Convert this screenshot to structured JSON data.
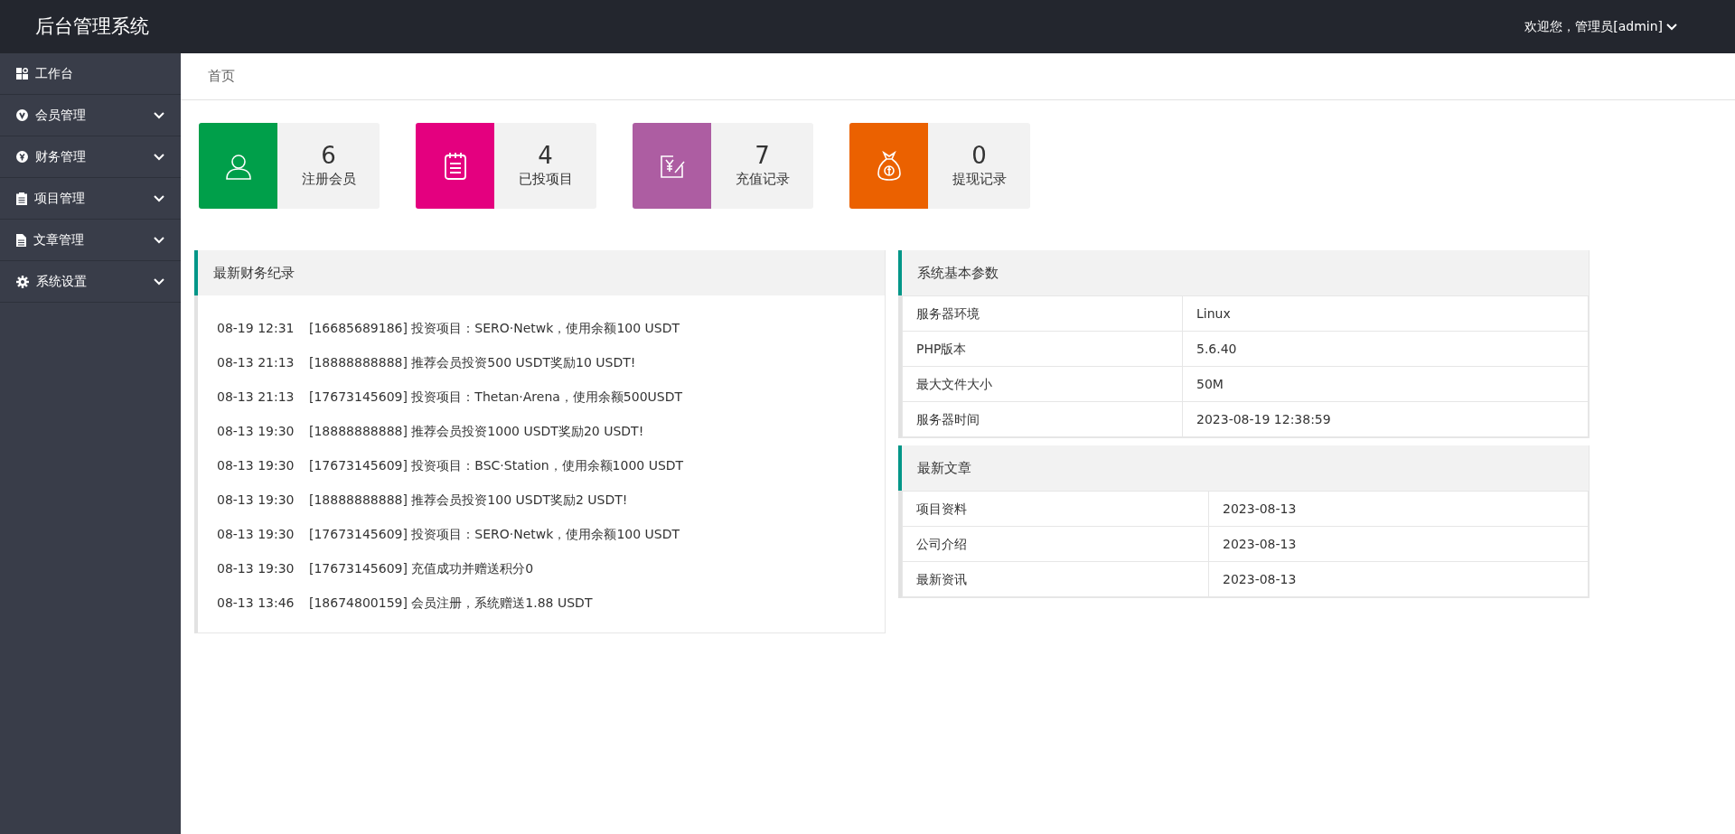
{
  "header": {
    "title": "后台管理系统",
    "user_menu": "欢迎您，管理员[admin]"
  },
  "sidebar": {
    "items": [
      {
        "label": "工作台",
        "kind": "link"
      },
      {
        "label": "会员管理",
        "kind": "menu",
        "expanded": false
      },
      {
        "label": "财务管理",
        "kind": "menu",
        "expanded": false
      },
      {
        "label": "项目管理",
        "kind": "menu",
        "expanded": false
      },
      {
        "label": "文章管理",
        "kind": "menu",
        "expanded": false
      },
      {
        "label": "系统设置",
        "kind": "menu",
        "expanded": false
      }
    ]
  },
  "breadcrumb": "首页",
  "stats": [
    {
      "value": "6",
      "label": "注册会员",
      "color": "#009f4a"
    },
    {
      "value": "4",
      "label": "已投项目",
      "color": "#e4007f"
    },
    {
      "value": "7",
      "label": "充值记录",
      "color": "#ad5da2"
    },
    {
      "value": "0",
      "label": "提现记录",
      "color": "#eb6100"
    }
  ],
  "finance_log": {
    "title": "最新财务纪录",
    "entries": [
      {
        "time": "08-19 12:31",
        "text": "[16685689186] 投资项目：SERO·Netwk，使用余额100 USDT"
      },
      {
        "time": "08-13 21:13",
        "text": "[18888888888] 推荐会员投资500 USDT奖励10 USDT!"
      },
      {
        "time": "08-13 21:13",
        "text": "[17673145609] 投资项目：Thetan·Arena，使用余额500USDT"
      },
      {
        "time": "08-13 19:30",
        "text": "[18888888888] 推荐会员投资1000 USDT奖励20 USDT!"
      },
      {
        "time": "08-13 19:30",
        "text": "[17673145609] 投资项目：BSC·Station，使用余额1000 USDT"
      },
      {
        "time": "08-13 19:30",
        "text": "[18888888888] 推荐会员投资100 USDT奖励2 USDT!"
      },
      {
        "time": "08-13 19:30",
        "text": "[17673145609] 投资项目：SERO·Netwk，使用余额100 USDT"
      },
      {
        "time": "08-13 19:30",
        "text": "[17673145609] 充值成功并赠送积分0"
      },
      {
        "time": "08-13 13:46",
        "text": "[18674800159] 会员注册，系统赠送1.88 USDT"
      }
    ]
  },
  "system_params": {
    "title": "系统基本参数",
    "rows": [
      [
        "服务器环境",
        "Linux"
      ],
      [
        "PHP版本",
        "5.6.40"
      ],
      [
        "最大文件大小",
        "50M"
      ],
      [
        "服务器时间",
        "2023-08-19 12:38:59"
      ]
    ]
  },
  "latest_articles": {
    "title": "最新文章",
    "rows": [
      [
        "项目资料",
        "2023-08-13"
      ],
      [
        "公司介绍",
        "2023-08-13"
      ],
      [
        "最新资讯",
        "2023-08-13"
      ]
    ]
  }
}
